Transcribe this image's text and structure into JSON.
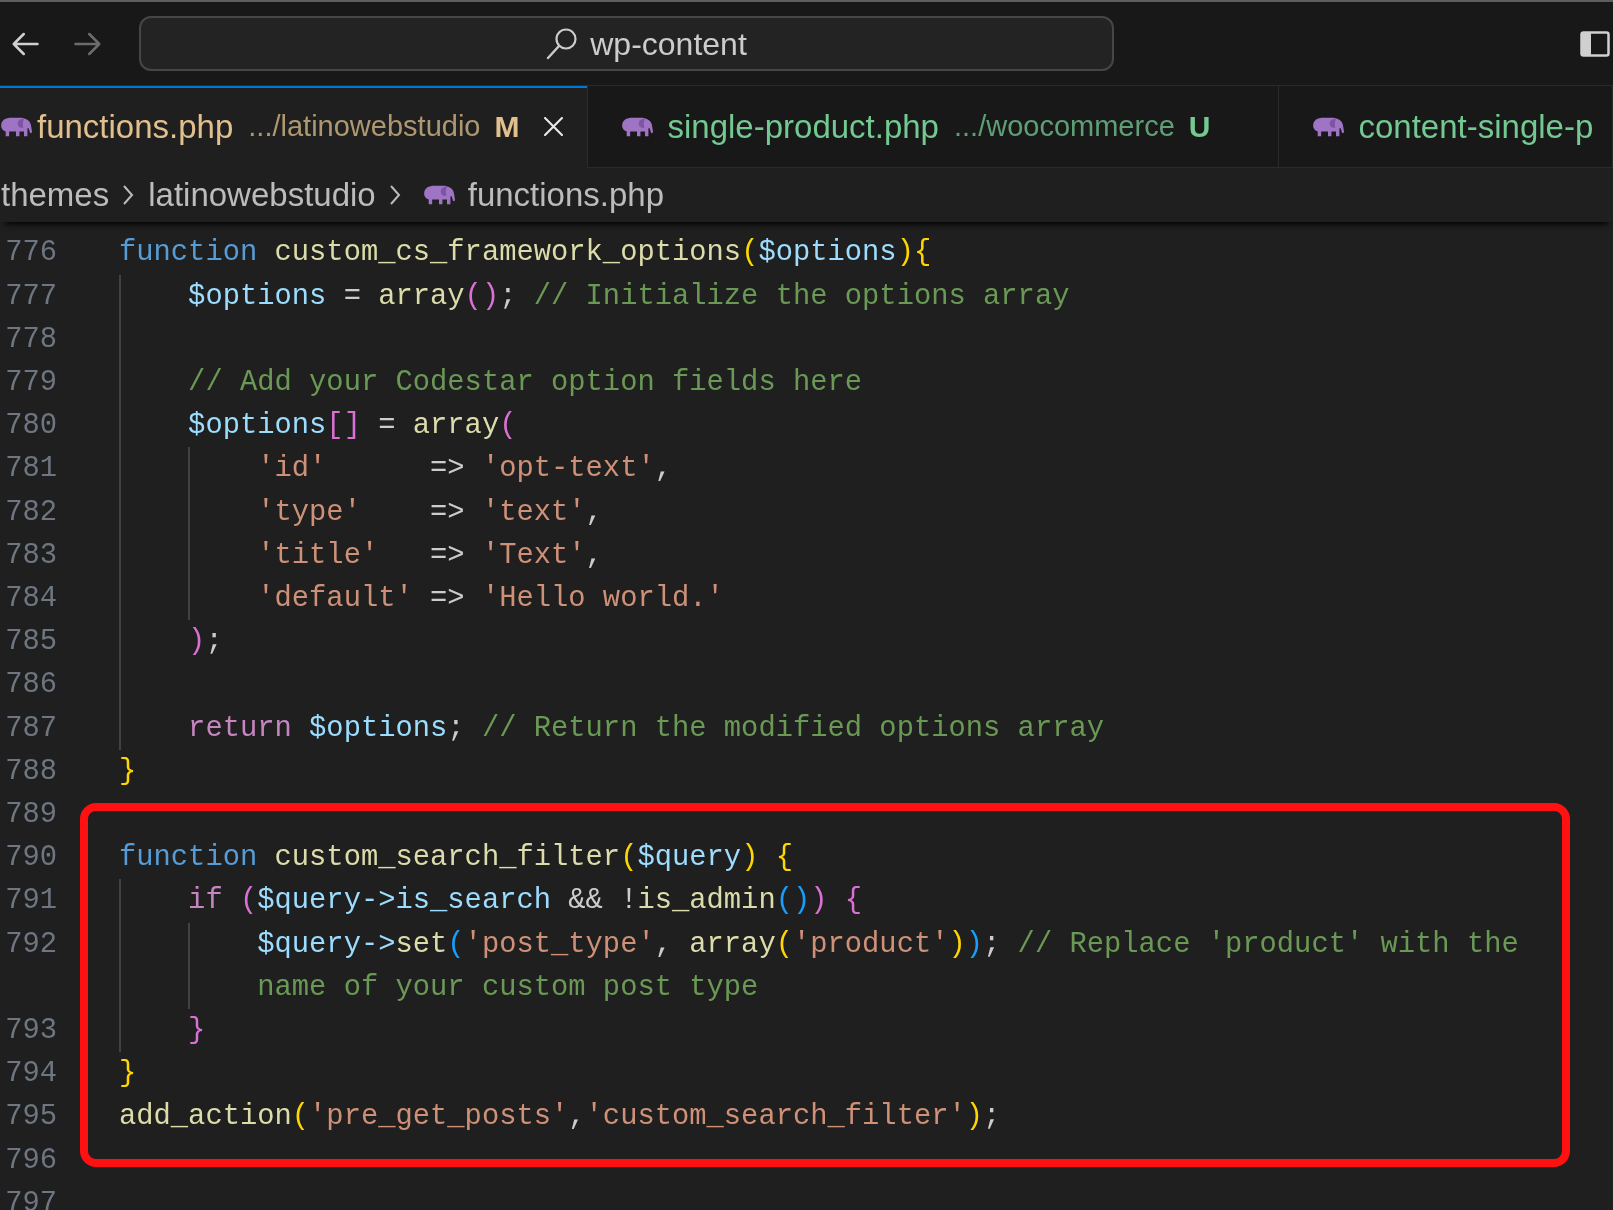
{
  "title_bar": {
    "nav_buttons": [
      {
        "kind": "back",
        "disabled": false
      },
      {
        "kind": "forward",
        "disabled": true
      }
    ],
    "command_center": {
      "label": "wp-content"
    }
  },
  "tabs": [
    {
      "label": "functions.php",
      "description": ".../latinowebstudio",
      "status_letter": "M",
      "kind": "modified",
      "selected": true
    },
    {
      "label": "single-product.php",
      "description": ".../woocommerce",
      "status_letter": "U",
      "kind": "untracked",
      "selected": false
    },
    {
      "label": "content-single-p",
      "kind": "untracked",
      "selected": false
    }
  ],
  "breadcrumbs": [
    {
      "label": "themes",
      "kind": "folder"
    },
    {
      "label": "latinowebstudio",
      "kind": "folder"
    },
    {
      "label": "functions.php",
      "kind": "file"
    }
  ],
  "editor": {
    "sections": [
      {
        "highlighted": false,
        "lines": [
          {
            "number": "776",
            "tokens": [
              {
                "kind": "keyword",
                "text": "function "
              },
              {
                "kind": "function",
                "text": "custom_cs_framework_options"
              },
              {
                "kind": "bracket1",
                "text": "("
              },
              {
                "kind": "variable",
                "text": "$options"
              },
              {
                "kind": "bracket1",
                "text": "){"
              }
            ]
          },
          {
            "number": "777",
            "tokens": [
              {
                "kind": "variable",
                "text": "    $options"
              },
              {
                "kind": "plain",
                "text": " = "
              },
              {
                "kind": "function",
                "text": "array"
              },
              {
                "kind": "bracket2",
                "text": "()"
              },
              {
                "kind": "plain",
                "text": "; "
              },
              {
                "kind": "comment",
                "text": "// Initialize the options array"
              }
            ]
          },
          {
            "number": "778"
          },
          {
            "number": "779",
            "tokens": [
              {
                "kind": "comment",
                "text": "    // Add your Codestar option fields here"
              }
            ]
          },
          {
            "number": "780",
            "tokens": [
              {
                "kind": "variable",
                "text": "    $options"
              },
              {
                "kind": "bracket2",
                "text": "[]"
              },
              {
                "kind": "plain",
                "text": " = "
              },
              {
                "kind": "function",
                "text": "array"
              },
              {
                "kind": "bracket2",
                "text": "("
              }
            ]
          },
          {
            "number": "781",
            "tokens": [
              {
                "kind": "string",
                "text": "        'id'"
              },
              {
                "kind": "plain",
                "text": "      => "
              },
              {
                "kind": "string",
                "text": "'opt-text'"
              },
              {
                "kind": "plain",
                "text": ","
              }
            ]
          },
          {
            "number": "782",
            "tokens": [
              {
                "kind": "string",
                "text": "        'type'"
              },
              {
                "kind": "plain",
                "text": "    => "
              },
              {
                "kind": "string",
                "text": "'text'"
              },
              {
                "kind": "plain",
                "text": ","
              }
            ]
          },
          {
            "number": "783",
            "tokens": [
              {
                "kind": "string",
                "text": "        'title'"
              },
              {
                "kind": "plain",
                "text": "   => "
              },
              {
                "kind": "string",
                "text": "'Text'"
              },
              {
                "kind": "plain",
                "text": ","
              }
            ]
          },
          {
            "number": "784",
            "tokens": [
              {
                "kind": "string",
                "text": "        'default'"
              },
              {
                "kind": "plain",
                "text": " => "
              },
              {
                "kind": "string",
                "text": "'Hello world.'"
              }
            ]
          },
          {
            "number": "785",
            "tokens": [
              {
                "kind": "bracket2",
                "text": "    )"
              },
              {
                "kind": "plain",
                "text": ";"
              }
            ]
          },
          {
            "number": "786"
          },
          {
            "number": "787",
            "tokens": [
              {
                "kind": "control",
                "text": "    return "
              },
              {
                "kind": "variable",
                "text": "$options"
              },
              {
                "kind": "plain",
                "text": "; "
              },
              {
                "kind": "comment",
                "text": "// Return the modified options array"
              }
            ]
          },
          {
            "number": "788",
            "tokens": [
              {
                "kind": "bracket1",
                "text": "}"
              }
            ]
          },
          {
            "number": "789"
          }
        ]
      },
      {
        "highlighted": true,
        "lines": [
          {
            "number": "790",
            "tokens": [
              {
                "kind": "keyword",
                "text": "function "
              },
              {
                "kind": "function",
                "text": "custom_search_filter"
              },
              {
                "kind": "bracket1",
                "text": "("
              },
              {
                "kind": "variable",
                "text": "$query"
              },
              {
                "kind": "bracket1",
                "text": ") {"
              }
            ]
          },
          {
            "number": "791",
            "tokens": [
              {
                "kind": "control",
                "text": "    if "
              },
              {
                "kind": "bracket2",
                "text": "("
              },
              {
                "kind": "variable",
                "text": "$query->is_search"
              },
              {
                "kind": "plain",
                "text": " && !"
              },
              {
                "kind": "function",
                "text": "is_admin"
              },
              {
                "kind": "bracket3",
                "text": "()"
              },
              {
                "kind": "bracket2",
                "text": ") {"
              }
            ]
          },
          {
            "number": "792",
            "tokens": [
              {
                "kind": "variable",
                "text": "        $query->"
              },
              {
                "kind": "function",
                "text": "set"
              },
              {
                "kind": "bracket3",
                "text": "("
              },
              {
                "kind": "string",
                "text": "'post_type'"
              },
              {
                "kind": "plain",
                "text": ", "
              },
              {
                "kind": "function",
                "text": "array"
              },
              {
                "kind": "bracket1",
                "text": "("
              },
              {
                "kind": "string",
                "text": "'product'"
              },
              {
                "kind": "bracket1",
                "text": ")"
              },
              {
                "kind": "bracket3",
                "text": ")"
              },
              {
                "kind": "plain",
                "text": "; "
              },
              {
                "kind": "comment",
                "text": "// Replace 'product' with the name of your custom post type"
              }
            ]
          },
          {
            "number": "793",
            "tokens": [
              {
                "kind": "bracket2",
                "text": "    }"
              }
            ]
          },
          {
            "number": "794",
            "tokens": [
              {
                "kind": "bracket1",
                "text": "}"
              }
            ]
          },
          {
            "number": "795",
            "tokens": [
              {
                "kind": "function",
                "text": "add_action"
              },
              {
                "kind": "bracket1",
                "text": "("
              },
              {
                "kind": "string",
                "text": "'pre_get_posts'"
              },
              {
                "kind": "plain",
                "text": ","
              },
              {
                "kind": "string",
                "text": "'custom_search_filter'"
              },
              {
                "kind": "bracket1",
                "text": ")"
              },
              {
                "kind": "plain",
                "text": ";"
              }
            ]
          }
        ]
      },
      {
        "highlighted": false,
        "lines": [
          {
            "number": "796"
          },
          {
            "number": "797"
          }
        ]
      }
    ]
  }
}
